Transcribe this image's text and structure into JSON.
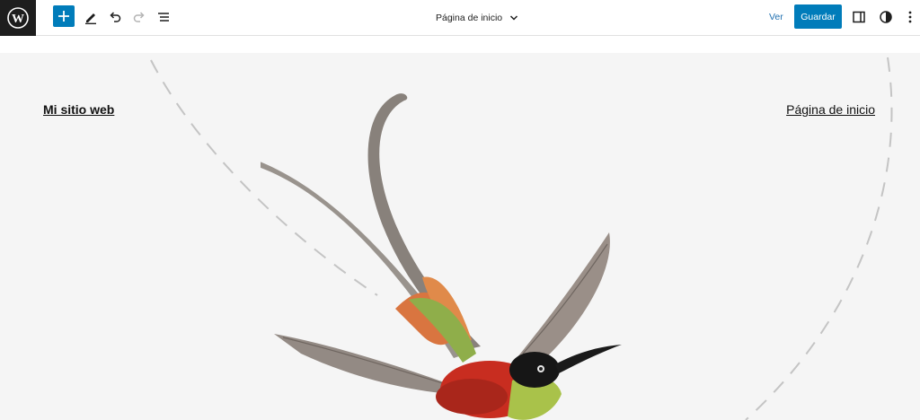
{
  "toolbar": {
    "logo_icon": "wordpress-logo-icon",
    "add_block_icon": "plus-icon",
    "tools_icon": "pencil-icon",
    "undo_icon": "undo-icon",
    "redo_icon": "redo-icon",
    "list_view_icon": "list-view-icon",
    "document_title": "Página de inicio",
    "document_title_icon": "chevron-down-icon",
    "view_label": "Ver",
    "save_label": "Guardar",
    "settings_icon": "sidebar-toggle-icon",
    "styles_icon": "half-circle-contrast-icon",
    "options_icon": "vertical-dots-icon"
  },
  "colors": {
    "accent": "#007cba",
    "link": "#2271b1",
    "logo_bg": "#1e1e1e",
    "canvas_bg": "#f5f5f5"
  },
  "canvas": {
    "site_title": "Mi sitio web",
    "nav_item": "Página de inicio",
    "image": "hummingbird-illustration"
  }
}
